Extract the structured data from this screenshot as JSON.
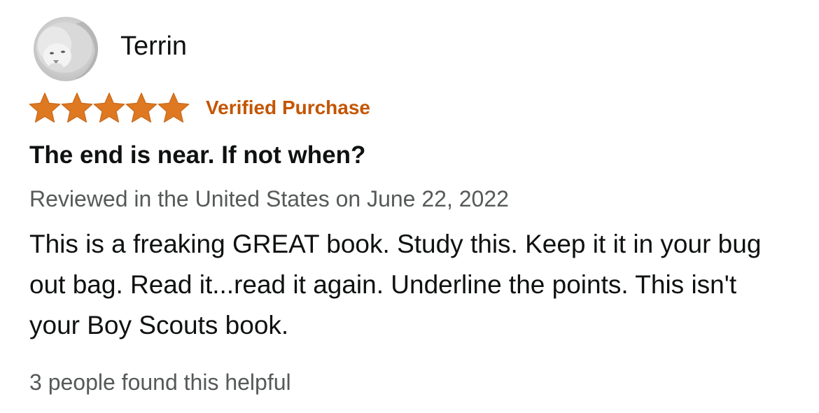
{
  "reviewer": {
    "name": "Terrin",
    "avatar_icon": "white-lion-avatar"
  },
  "rating": {
    "stars": 5,
    "max": 5,
    "star_color": "#de7921",
    "verified_label": "Verified Purchase",
    "verified_color": "#c45500"
  },
  "review": {
    "title": "The end is near. If not when?",
    "meta": "Reviewed in the United States on June 22, 2022",
    "body": "This is a freaking GREAT book. Study this. Keep it it in your bug out bag. Read it...read it again. Underline the points. This isn't your Boy Scouts book.",
    "helpful": "3 people found this helpful"
  }
}
